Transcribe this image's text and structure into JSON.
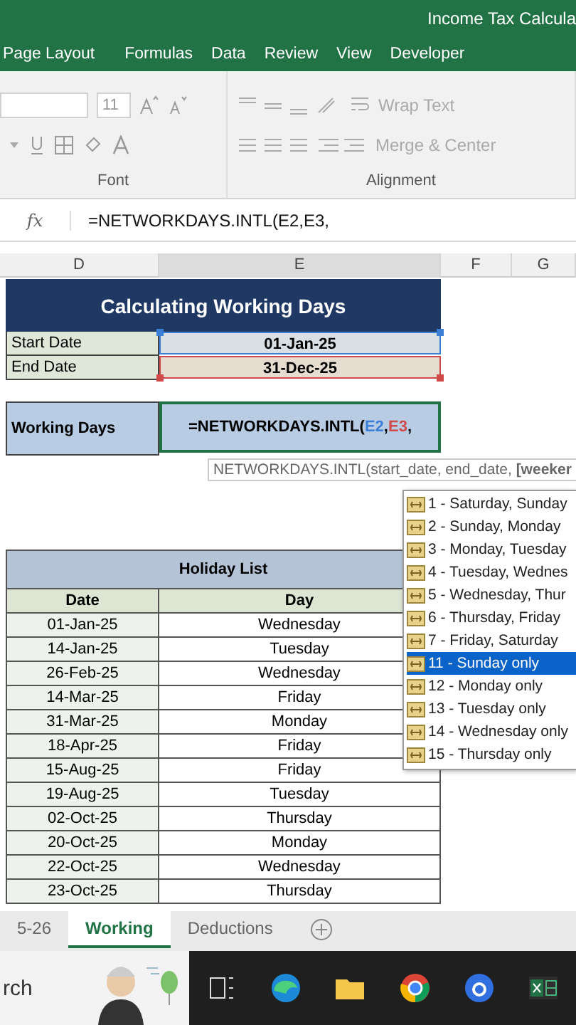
{
  "title_bar": {
    "title": "Income Tax Calcula"
  },
  "ribbon_tabs": [
    "Page Layout",
    "Formulas",
    "Data",
    "Review",
    "View",
    "Developer"
  ],
  "ribbon": {
    "font_size": "11",
    "wrap_text": "Wrap Text",
    "merge_center": "Merge & Center",
    "font_group": "Font",
    "alignment_group": "Alignment"
  },
  "formula_bar": {
    "fx": "fx",
    "formula": "=NETWORKDAYS.INTL(E2,E3,"
  },
  "columns": [
    "D",
    "E",
    "F",
    "G"
  ],
  "summary": {
    "title": "Calculating Working Days",
    "start_label": "Start Date",
    "start_value": "01-Jan-25",
    "end_label": "End Date",
    "end_value": "31-Dec-25",
    "working_label": "Working Days",
    "working_formula": [
      {
        "text": "=NETWORKDAYS.INTL("
      },
      {
        "text": "E2",
        "color": "#3a7fd5"
      },
      {
        "text": ","
      },
      {
        "text": "E3",
        "color": "#d04a4a"
      },
      {
        "text": ","
      }
    ]
  },
  "tooltip": "NETWORKDAYS.INTL(start_date, end_date, **[weeker**",
  "holiday_list": {
    "title": "Holiday List",
    "columns": [
      "Date",
      "Day"
    ],
    "rows": [
      [
        "01-Jan-25",
        "Wednesday"
      ],
      [
        "14-Jan-25",
        "Tuesday"
      ],
      [
        "26-Feb-25",
        "Wednesday"
      ],
      [
        "14-Mar-25",
        "Friday"
      ],
      [
        "31-Mar-25",
        "Monday"
      ],
      [
        "18-Apr-25",
        "Friday"
      ],
      [
        "15-Aug-25",
        "Friday"
      ],
      [
        "19-Aug-25",
        "Tuesday"
      ],
      [
        "02-Oct-25",
        "Thursday"
      ],
      [
        "20-Oct-25",
        "Monday"
      ],
      [
        "22-Oct-25",
        "Wednesday"
      ],
      [
        "23-Oct-25",
        "Thursday"
      ]
    ]
  },
  "weekend_menu": [
    {
      "label": "1 - Saturday, Sunday",
      "selected": false
    },
    {
      "label": "2 - Sunday, Monday",
      "selected": false
    },
    {
      "label": "3 - Monday, Tuesday",
      "selected": false
    },
    {
      "label": "4 - Tuesday, Wednes",
      "selected": false
    },
    {
      "label": "5 - Wednesday, Thur",
      "selected": false
    },
    {
      "label": "6 - Thursday, Friday",
      "selected": false
    },
    {
      "label": "7 - Friday, Saturday",
      "selected": false
    },
    {
      "label": "11 - Sunday only",
      "selected": true
    },
    {
      "label": "12 - Monday only",
      "selected": false
    },
    {
      "label": "13 - Tuesday only",
      "selected": false
    },
    {
      "label": "14 - Wednesday only",
      "selected": false
    },
    {
      "label": "15 - Thursday only",
      "selected": false
    }
  ],
  "sheet_tabs": [
    {
      "label": "5-26",
      "selected": false
    },
    {
      "label": "Working",
      "selected": true
    },
    {
      "label": "Deductions",
      "selected": false
    }
  ],
  "taskbar": {
    "search": "rch"
  }
}
